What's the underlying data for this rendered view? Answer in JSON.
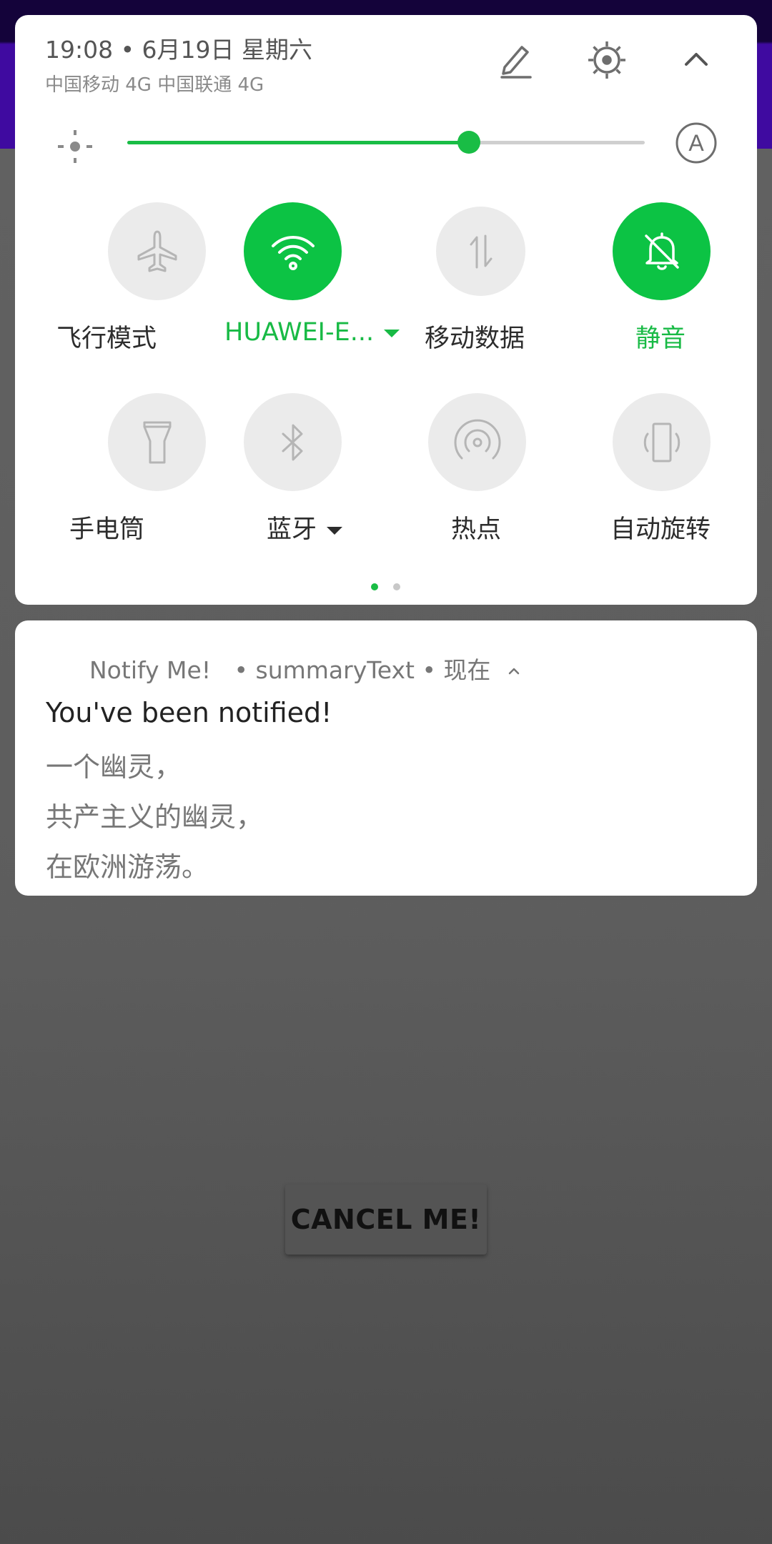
{
  "status_header": {
    "time_date": "19:08 • 6月19日 星期六",
    "carriers": "中国移动 4G  中国联通 4G"
  },
  "brightness": {
    "level_fraction": 0.66
  },
  "quick_tiles": [
    {
      "label": "飞行模式",
      "icon": "airplane-icon",
      "active": false,
      "has_dropdown": false
    },
    {
      "label": "HUAWEI-E...",
      "icon": "wifi-icon",
      "active": true,
      "has_dropdown": true
    },
    {
      "label": "移动数据",
      "icon": "mobile-data-icon",
      "active": false,
      "has_dropdown": false
    },
    {
      "label": "静音",
      "icon": "bell-off-icon",
      "active": true,
      "has_dropdown": false
    },
    {
      "label": "手电筒",
      "icon": "flashlight-icon",
      "active": false,
      "has_dropdown": false
    },
    {
      "label": "蓝牙",
      "icon": "bluetooth-icon",
      "active": false,
      "has_dropdown": true
    },
    {
      "label": "热点",
      "icon": "hotspot-icon",
      "active": false,
      "has_dropdown": false
    },
    {
      "label": "自动旋转",
      "icon": "auto-rotate-icon",
      "active": false,
      "has_dropdown": false
    }
  ],
  "page_indicator": {
    "current": 1,
    "total": 2
  },
  "notification": {
    "app_name": "Notify Me!",
    "summary": "• summaryText • 现在",
    "title": "You've been notified!",
    "lines": [
      "一个幽灵，",
      "共产主义的幽灵，",
      "在欧洲游荡。"
    ]
  },
  "app": {
    "cancel_button": "CANCEL ME!"
  },
  "colors": {
    "accent_green": "#19bd45",
    "tile_off": "#ebebeb",
    "app_bar": "#3f0aa0"
  }
}
